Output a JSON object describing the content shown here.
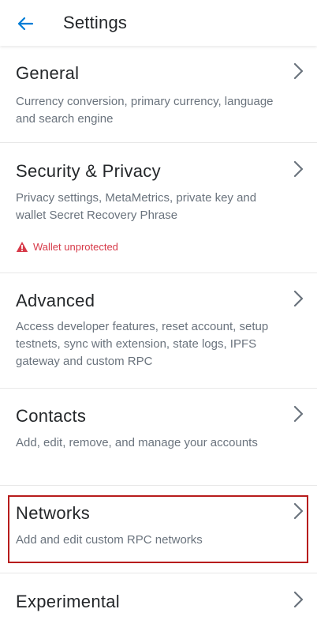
{
  "header": {
    "title": "Settings",
    "back_icon": "arrow-left-icon",
    "accent_color": "#037dd6"
  },
  "settings": {
    "general": {
      "title": "General",
      "description": "Currency conversion, primary currency, language and search engine"
    },
    "security": {
      "title": "Security & Privacy",
      "description": "Privacy settings, MetaMetrics, private key and wallet Secret Recovery Phrase",
      "warning": "Wallet unprotected",
      "warning_color": "#d73a49"
    },
    "advanced": {
      "title": "Advanced",
      "description": "Access developer features, reset account, setup testnets, sync with extension, state logs, IPFS gateway and custom RPC"
    },
    "contacts": {
      "title": "Contacts",
      "description": "Add, edit, remove, and manage your accounts"
    },
    "networks": {
      "title": "Networks",
      "description": "Add and edit custom RPC networks",
      "highlight_color": "#b71c1c"
    },
    "experimental": {
      "title": "Experimental"
    }
  }
}
